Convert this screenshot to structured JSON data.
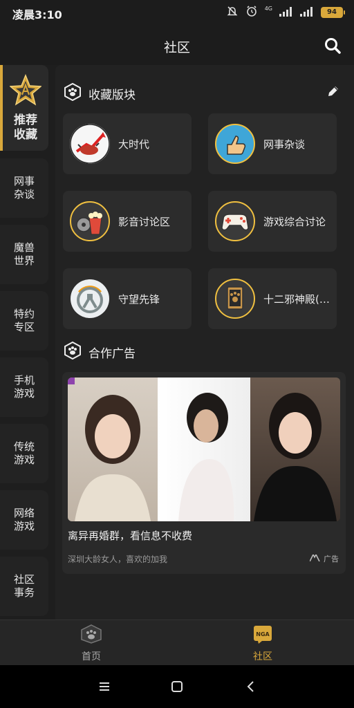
{
  "status": {
    "time": "凌晨3:10",
    "network": "4G",
    "battery": "94"
  },
  "header": {
    "title": "社区"
  },
  "sidebar": {
    "items": [
      {
        "label": "推荐收藏",
        "active": true
      },
      {
        "label": "网事杂谈"
      },
      {
        "label": "魔兽世界"
      },
      {
        "label": "特约专区"
      },
      {
        "label": "手机游戏"
      },
      {
        "label": "传统游戏"
      },
      {
        "label": "网络游戏"
      },
      {
        "label": "社区事务"
      }
    ]
  },
  "favorites": {
    "title": "收藏版块",
    "boards": [
      {
        "name": "大时代",
        "icon": "bull-icon"
      },
      {
        "name": "网事杂谈",
        "icon": "thumbs-up-icon"
      },
      {
        "name": "影音讨论区",
        "icon": "popcorn-icon"
      },
      {
        "name": "游戏综合讨论",
        "icon": "gamepad-icon"
      },
      {
        "name": "守望先锋",
        "icon": "overwatch-icon"
      },
      {
        "name": "十二邪神殿(笑...",
        "icon": "card-icon"
      }
    ]
  },
  "partner": {
    "title": "合作广告",
    "ad": {
      "headline": "离异再婚群，看信息不收费",
      "subtitle": "深圳大龄女人，喜欢的加我",
      "tag": "广告"
    }
  },
  "tabs": [
    {
      "label": "首页",
      "active": false
    },
    {
      "label": "社区",
      "active": true
    }
  ],
  "colors": {
    "accent": "#d9a83b",
    "background": "#1e1e1e",
    "card": "#2c2c2c"
  }
}
